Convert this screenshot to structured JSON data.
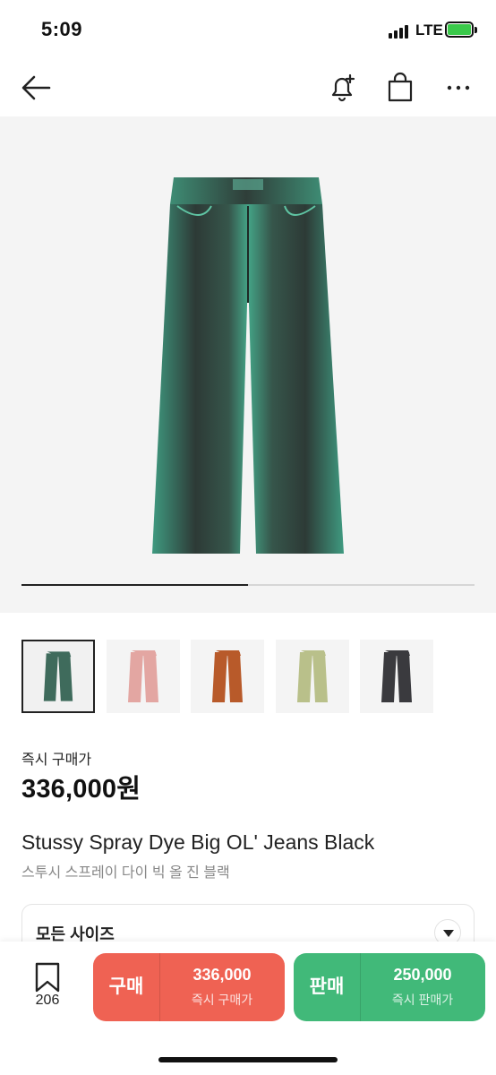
{
  "status_bar": {
    "time": "5:09",
    "network": "LTE",
    "battery_charging": true
  },
  "nav": {
    "back_icon": "arrow-left-icon",
    "alert_icon": "bell-plus-icon",
    "shop_icon": "shopping-bag-icon",
    "more_icon": "more-dots-icon"
  },
  "gallery": {
    "progress": 0.5,
    "thumbnails": [
      {
        "label": "green",
        "color": "#3f6b5c",
        "selected": true
      },
      {
        "label": "pink",
        "color": "#e3a6a2",
        "selected": false
      },
      {
        "label": "orange-camo",
        "color": "#b85a2a",
        "selected": false
      },
      {
        "label": "olive",
        "color": "#b9c08a",
        "selected": false
      },
      {
        "label": "black",
        "color": "#3a3a3e",
        "selected": false
      }
    ]
  },
  "price": {
    "label": "즉시 구매가",
    "value": "336,000원"
  },
  "product": {
    "name_en": "Stussy Spray Dye Big OL' Jeans Black",
    "name_ko": "스투시 스프레이 다이 빅 올 진 블랙"
  },
  "size_select": {
    "label": "모든 사이즈"
  },
  "bottom_bar": {
    "bookmark_count": "206",
    "buy": {
      "type": "구매",
      "price": "336,000",
      "sub": "즉시 구매가",
      "color": "#ef6253"
    },
    "sell": {
      "type": "판매",
      "price": "250,000",
      "sub": "즉시 판매가",
      "color": "#41b979"
    }
  }
}
